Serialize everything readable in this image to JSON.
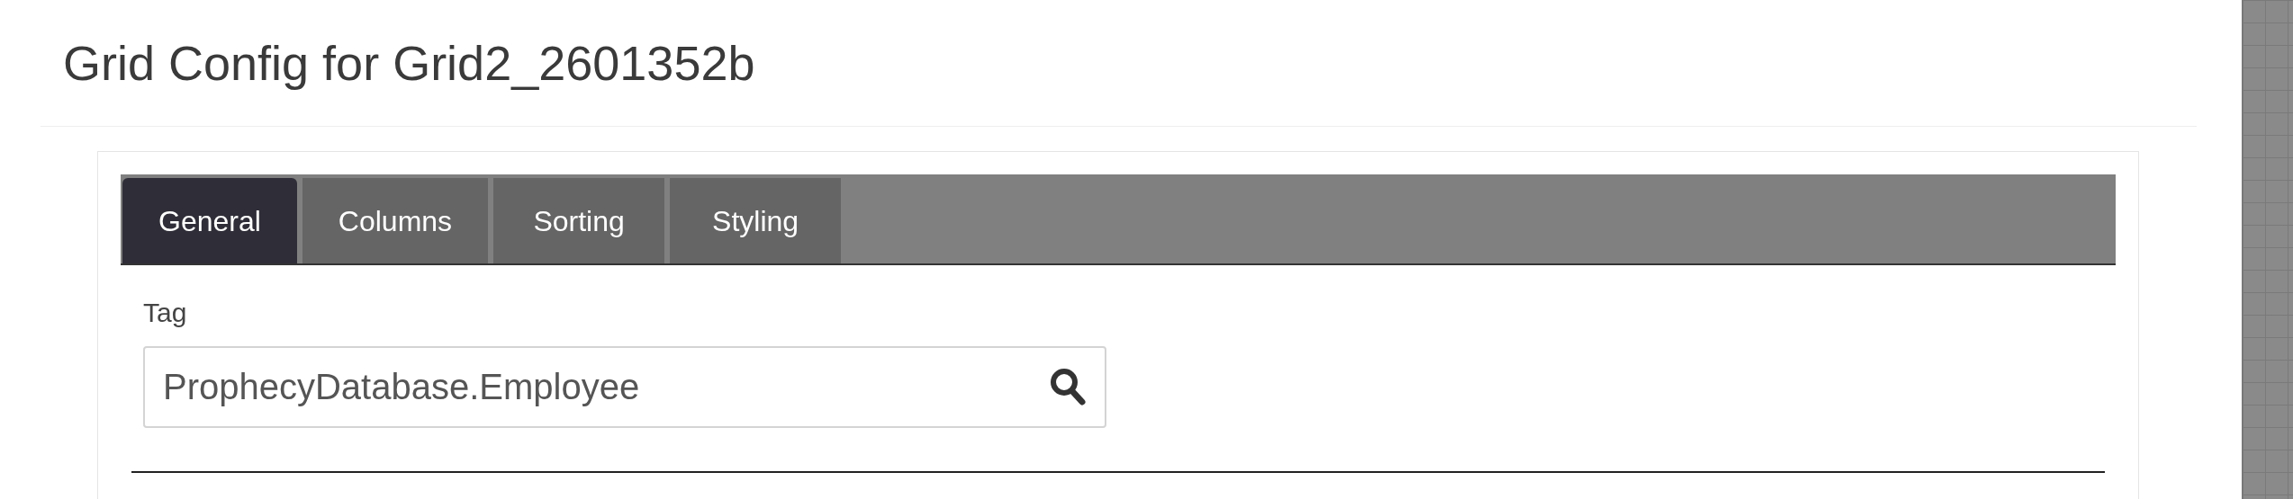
{
  "title": "Grid Config for Grid2_2601352b",
  "tabs": [
    {
      "label": "General",
      "selected": true
    },
    {
      "label": "Columns",
      "selected": false
    },
    {
      "label": "Sorting",
      "selected": false
    },
    {
      "label": "Styling",
      "selected": false
    }
  ],
  "tag_field": {
    "label": "Tag",
    "value": "ProphecyDatabase.Employee"
  }
}
